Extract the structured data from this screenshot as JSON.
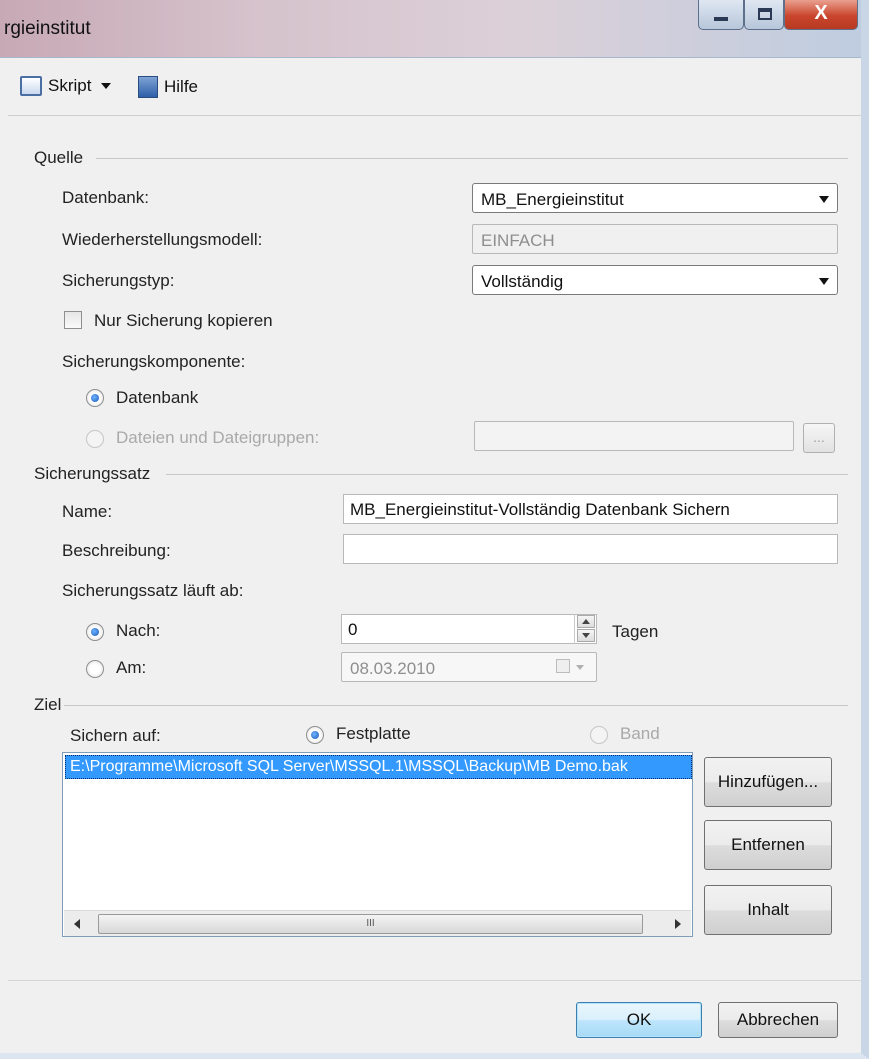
{
  "window": {
    "title": "rgieinstitut",
    "controls": {
      "minimize_icon": "minimize-icon",
      "maximize_icon": "maximize-icon",
      "close_icon": "close-icon",
      "close_glyph": "X"
    }
  },
  "toolbar": {
    "script_label": "Skript",
    "help_label": "Hilfe"
  },
  "source": {
    "header": "Quelle",
    "database_label": "Datenbank:",
    "database_value": "MB_Energieinstitut",
    "recovery_model_label": "Wiederherstellungsmodell:",
    "recovery_model_value": "EINFACH",
    "backup_type_label": "Sicherungstyp:",
    "backup_type_value": "Vollständig",
    "copy_only_label": "Nur Sicherung kopieren",
    "copy_only_checked": false,
    "component_label": "Sicherungskomponente:",
    "component_database": "Datenbank",
    "component_files": "Dateien und Dateigruppen:",
    "browse_label": "..."
  },
  "backup_set": {
    "header": "Sicherungssatz",
    "name_label": "Name:",
    "name_value": "MB_Energieinstitut-Vollständig Datenbank Sichern",
    "description_label": "Beschreibung:",
    "description_value": "",
    "expires_label": "Sicherungssatz läuft ab:",
    "after_label": "Nach:",
    "after_value": "0",
    "days_label": "Tagen",
    "on_label": "Am:",
    "on_value": "08.03.2010"
  },
  "destination": {
    "header": "Ziel",
    "backup_to_label": "Sichern auf:",
    "disk_label": "Festplatte",
    "tape_label": "Band",
    "paths": [
      "E:\\Programme\\Microsoft SQL Server\\MSSQL.1\\MSSQL\\Backup\\MB Demo.bak"
    ],
    "scroll_thumb_grip": "III",
    "add_label": "Hinzufügen...",
    "remove_label": "Entfernen",
    "contents_label": "Inhalt"
  },
  "footer": {
    "ok_label": "OK",
    "cancel_label": "Abbrechen"
  },
  "colors": {
    "selection": "#3399ff",
    "window_bg": "#f0f0f0",
    "radio_dot": "#1759b8"
  }
}
